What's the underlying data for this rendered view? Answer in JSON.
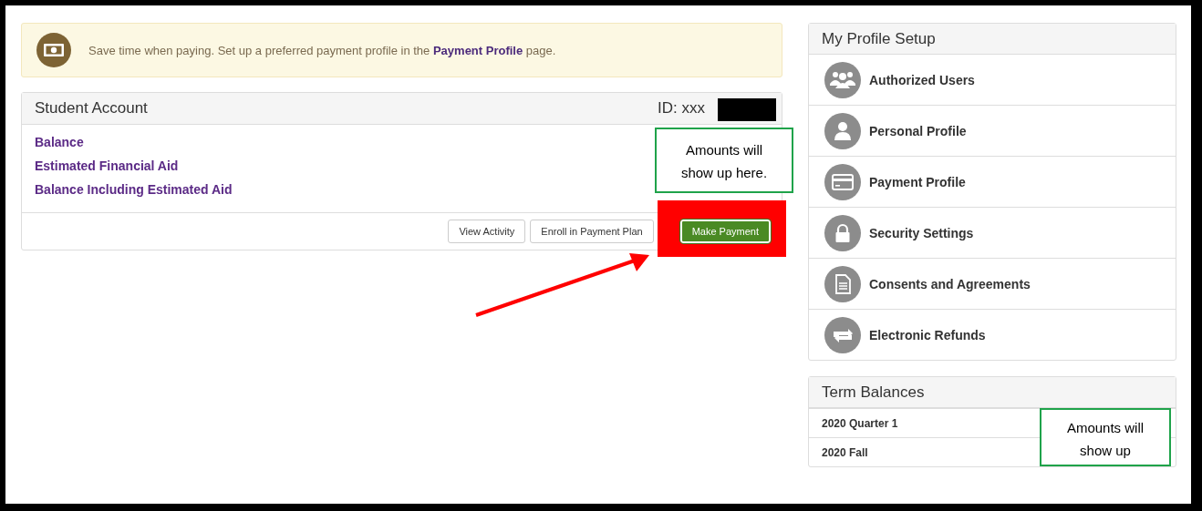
{
  "notice": {
    "text_before": "Save time when paying. Set up a preferred payment profile in the ",
    "link": "Payment Profile",
    "text_after": " page."
  },
  "student_account": {
    "title": "Student Account",
    "id": "ID: xxx",
    "items": [
      "Balance",
      "Estimated Financial Aid",
      "Balance Including Estimated Aid"
    ],
    "buttons": [
      {
        "label": "View Activity",
        "kind": "default"
      },
      {
        "label": "Enroll in Payment Plan",
        "kind": "default"
      },
      {
        "label": "Make Payment",
        "kind": "primary"
      }
    ],
    "callout": "Amounts will show up here."
  },
  "profile_setup": {
    "title": "My Profile Setup",
    "items": [
      "Authorized Users",
      "Personal Profile",
      "Payment Profile",
      "Security Settings",
      "Consents and Agreements",
      "Electronic Refunds"
    ]
  },
  "term_balances": {
    "title": "Term Balances",
    "rows": [
      "2020 Quarter 1",
      "2020 Fall"
    ],
    "callout": "Amounts will show up"
  },
  "markup": [
    {
      "kind": "redaction"
    },
    {
      "kind": "highlight"
    },
    {
      "kind": "arrow"
    }
  ]
}
